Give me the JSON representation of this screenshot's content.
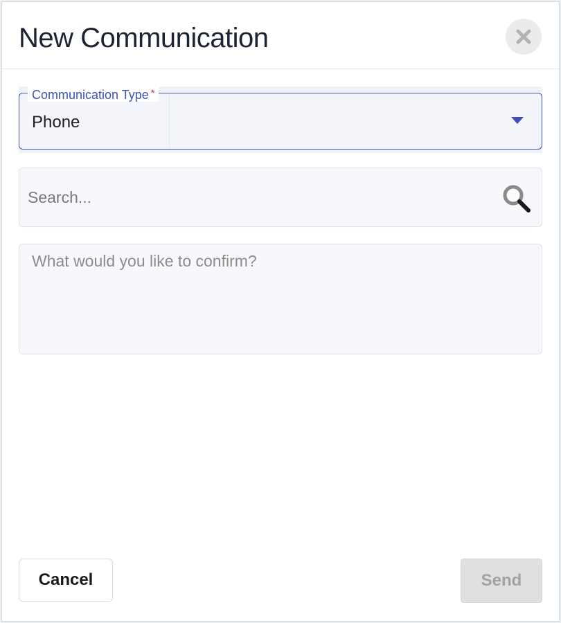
{
  "dialog": {
    "title": "New Communication",
    "close_icon": "close-icon"
  },
  "communication_type": {
    "label": "Communication Type",
    "required_marker": "*",
    "selected_value": "Phone",
    "caret_icon": "caret-down-icon",
    "accent_color": "#3f51b5"
  },
  "search": {
    "value": "",
    "placeholder": "Search...",
    "icon": "search-icon"
  },
  "message": {
    "value": "",
    "placeholder": "What would you like to confirm?"
  },
  "footer": {
    "cancel_label": "Cancel",
    "send_label": "Send",
    "send_enabled": false
  }
}
